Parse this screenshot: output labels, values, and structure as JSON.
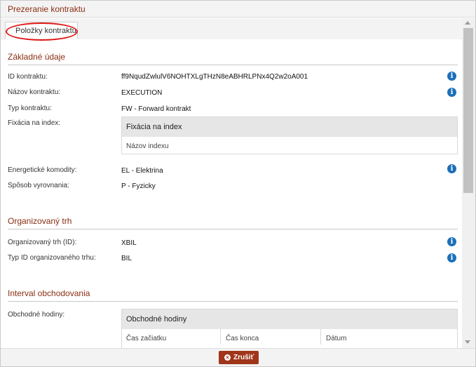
{
  "dialog": {
    "title": "Prezeranie kontraktu"
  },
  "tabs": [
    {
      "label": "Položky kontraktu"
    }
  ],
  "sections": {
    "basic": {
      "title": "Základné údaje",
      "fields": {
        "contract_id": {
          "label": "ID kontraktu:",
          "value": "ff9NqudZwlulV6NOHTXLgTHzN8eABHRLPNx4Q2w2oA001"
        },
        "contract_name": {
          "label": "Názov kontraktu:",
          "value": "EXECUTION"
        },
        "contract_type": {
          "label": "Typ kontraktu:",
          "value": "FW - Forward kontrakt"
        },
        "index_fixing": {
          "label": "Fixácia na index:"
        },
        "commodities": {
          "label": "Energetické komodity:",
          "value": "EL - Elektrina"
        },
        "settlement": {
          "label": "Spôsob vyrovnania:",
          "value": "P - Fyzicky"
        }
      },
      "index_panel": {
        "title": "Fixácia na index",
        "columns": [
          "Názov indexu"
        ]
      }
    },
    "market": {
      "title": "Organizovaný trh",
      "fields": {
        "market_id": {
          "label": "Organizovaný trh (ID):",
          "value": "XBIL"
        },
        "market_id_type": {
          "label": "Typ ID organizovaného trhu:",
          "value": "BIL"
        }
      }
    },
    "interval": {
      "title": "Interval obchodovania",
      "fields": {
        "trading_hours": {
          "label": "Obchodné hodiny:"
        }
      },
      "hours_panel": {
        "title": "Obchodné hodiny",
        "columns": [
          "Čas začiatku",
          "Čas konca",
          "Dátum"
        ]
      }
    }
  },
  "footer": {
    "cancel_label": "Zrušiť"
  },
  "icons": {
    "info": "info-icon",
    "cancel": "close-circle-icon"
  },
  "colors": {
    "accent": "#8a2e12",
    "button": "#a0351a",
    "info": "#1c6fb8",
    "highlight_circle": "#e01818"
  }
}
